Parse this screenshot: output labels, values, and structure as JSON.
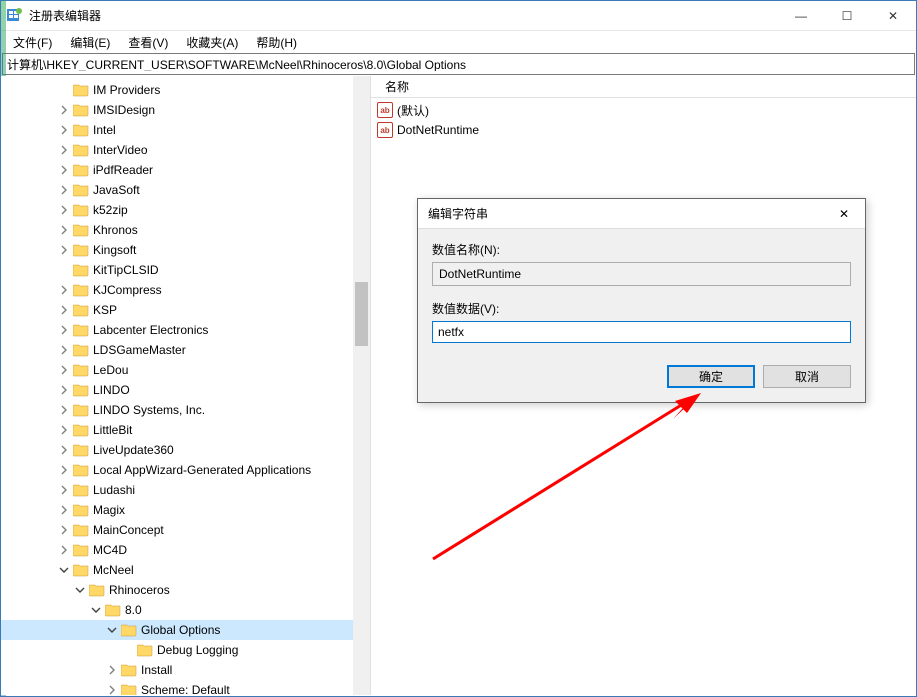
{
  "window": {
    "title": "注册表编辑器",
    "min": "—",
    "max": "☐",
    "close": "✕"
  },
  "menu": {
    "file": "文件(F)",
    "edit": "编辑(E)",
    "view": "查看(V)",
    "favorites": "收藏夹(A)",
    "help": "帮助(H)"
  },
  "address": "计算机\\HKEY_CURRENT_USER\\SOFTWARE\\McNeel\\Rhinoceros\\8.0\\Global Options",
  "columns": {
    "name": "名称"
  },
  "values": [
    {
      "name": "(默认)"
    },
    {
      "name": "DotNetRuntime"
    }
  ],
  "tree": [
    {
      "depth": 3,
      "label": "IM Providers",
      "expander": ""
    },
    {
      "depth": 3,
      "label": "IMSIDesign",
      "expander": ">"
    },
    {
      "depth": 3,
      "label": "Intel",
      "expander": ">"
    },
    {
      "depth": 3,
      "label": "InterVideo",
      "expander": ">"
    },
    {
      "depth": 3,
      "label": "iPdfReader",
      "expander": ">"
    },
    {
      "depth": 3,
      "label": "JavaSoft",
      "expander": ">"
    },
    {
      "depth": 3,
      "label": "k52zip",
      "expander": ">"
    },
    {
      "depth": 3,
      "label": "Khronos",
      "expander": ">"
    },
    {
      "depth": 3,
      "label": "Kingsoft",
      "expander": ">"
    },
    {
      "depth": 3,
      "label": "KitTipCLSID",
      "expander": ""
    },
    {
      "depth": 3,
      "label": "KJCompress",
      "expander": ">"
    },
    {
      "depth": 3,
      "label": "KSP",
      "expander": ">"
    },
    {
      "depth": 3,
      "label": "Labcenter Electronics",
      "expander": ">"
    },
    {
      "depth": 3,
      "label": "LDSGameMaster",
      "expander": ">"
    },
    {
      "depth": 3,
      "label": "LeDou",
      "expander": ">"
    },
    {
      "depth": 3,
      "label": "LINDO",
      "expander": ">"
    },
    {
      "depth": 3,
      "label": "LINDO Systems, Inc.",
      "expander": ">"
    },
    {
      "depth": 3,
      "label": "LittleBit",
      "expander": ">"
    },
    {
      "depth": 3,
      "label": "LiveUpdate360",
      "expander": ">"
    },
    {
      "depth": 3,
      "label": "Local AppWizard-Generated Applications",
      "expander": ">"
    },
    {
      "depth": 3,
      "label": "Ludashi",
      "expander": ">"
    },
    {
      "depth": 3,
      "label": "Magix",
      "expander": ">"
    },
    {
      "depth": 3,
      "label": "MainConcept",
      "expander": ">"
    },
    {
      "depth": 3,
      "label": "MC4D",
      "expander": ">"
    },
    {
      "depth": 3,
      "label": "McNeel",
      "expander": "v"
    },
    {
      "depth": 4,
      "label": "Rhinoceros",
      "expander": "v"
    },
    {
      "depth": 5,
      "label": "8.0",
      "expander": "v"
    },
    {
      "depth": 6,
      "label": "Global Options",
      "expander": "v",
      "selected": true
    },
    {
      "depth": 7,
      "label": "Debug Logging",
      "expander": ""
    },
    {
      "depth": 6,
      "label": "Install",
      "expander": ">"
    },
    {
      "depth": 6,
      "label": "Scheme: Default",
      "expander": ">"
    }
  ],
  "dialog": {
    "title": "编辑字符串",
    "name_label": "数值名称(N):",
    "name_value": "DotNetRuntime",
    "data_label": "数值数据(V):",
    "data_value": "netfx",
    "ok": "确定",
    "cancel": "取消",
    "close": "✕"
  }
}
